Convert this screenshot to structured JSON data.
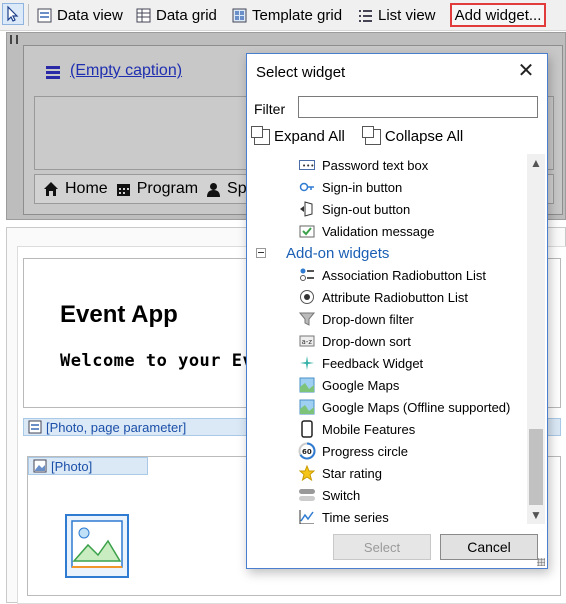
{
  "toolbar": {
    "items": [
      {
        "label": "Data view",
        "icon": "data-view-icon"
      },
      {
        "label": "Data grid",
        "icon": "data-grid-icon"
      },
      {
        "label": "Template grid",
        "icon": "template-grid-icon"
      },
      {
        "label": "List view",
        "icon": "list-view-icon"
      }
    ],
    "add_widget_label": "Add widget...",
    "highlight_color": "#e23b3b"
  },
  "page": {
    "empty_caption": "(Empty caption)",
    "nav_items": [
      "Home",
      "Program",
      "Sp"
    ],
    "event_title": "Event App",
    "welcome_text": "Welcome to your Ev",
    "photo_param_label": "[Photo, page parameter]",
    "photo_label": "[Photo]"
  },
  "dialog": {
    "title": "Select widget",
    "filter_label": "Filter",
    "filter_value": "",
    "expand_all": "Expand All",
    "collapse_all": "Collapse All",
    "select_button": "Select",
    "cancel_button": "Cancel",
    "accent": "#1a5fb4",
    "tree": [
      {
        "type": "item",
        "label": "Password text box",
        "icon": "password-textbox-icon"
      },
      {
        "type": "item",
        "label": "Sign-in button",
        "icon": "sign-in-icon"
      },
      {
        "type": "item",
        "label": "Sign-out button",
        "icon": "sign-out-icon"
      },
      {
        "type": "item",
        "label": "Validation message",
        "icon": "validation-icon"
      },
      {
        "type": "group",
        "label": "Add-on widgets",
        "expanded": true
      },
      {
        "type": "item",
        "label": "Association Radiobutton List",
        "icon": "radio-list-icon"
      },
      {
        "type": "item",
        "label": "Attribute Radiobutton List",
        "icon": "radio-icon"
      },
      {
        "type": "item",
        "label": "Drop-down filter",
        "icon": "funnel-icon"
      },
      {
        "type": "item",
        "label": "Drop-down sort",
        "icon": "sort-icon"
      },
      {
        "type": "item",
        "label": "Feedback Widget",
        "icon": "feedback-icon"
      },
      {
        "type": "item",
        "label": "Google Maps",
        "icon": "map-icon"
      },
      {
        "type": "item",
        "label": "Google Maps (Offline supported)",
        "icon": "map-icon"
      },
      {
        "type": "item",
        "label": "Mobile Features",
        "icon": "mobile-icon"
      },
      {
        "type": "item",
        "label": "Progress circle",
        "icon": "progress-circle-icon",
        "badge": "60"
      },
      {
        "type": "item",
        "label": "Star rating",
        "icon": "star-icon"
      },
      {
        "type": "item",
        "label": "Switch",
        "icon": "switch-icon"
      },
      {
        "type": "item",
        "label": "Time series",
        "icon": "chart-icon"
      }
    ]
  }
}
